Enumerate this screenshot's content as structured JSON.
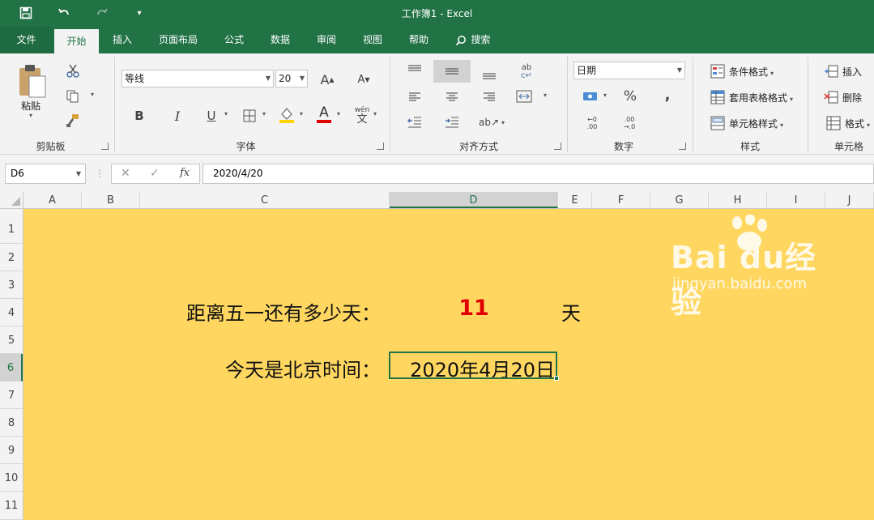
{
  "title": {
    "text": "工作簿1  -  Excel"
  },
  "tabs": [
    "文件",
    "开始",
    "插入",
    "页面布局",
    "公式",
    "数据",
    "审阅",
    "视图",
    "帮助",
    "搜索"
  ],
  "ribbon": {
    "clipboard": {
      "paste": "粘贴",
      "label": "剪贴板"
    },
    "font": {
      "name": "等线",
      "size": "20",
      "label": "字体",
      "bold": "B",
      "italic": "I",
      "underline": "U",
      "wen": "wén",
      "wen2": "文"
    },
    "align": {
      "label": "对齐方式"
    },
    "number": {
      "format": "日期",
      "percent": "%",
      "comma": ",",
      "label": "数字"
    },
    "styles": {
      "conditional": "条件格式",
      "table": "套用表格格式",
      "cell": "单元格样式",
      "label": "样式"
    },
    "cells": {
      "insert": "插入",
      "delete": "删除",
      "format": "格式",
      "label": "单元格"
    }
  },
  "formula_bar": {
    "namebox": "D6",
    "formula": "2020/4/20",
    "fx": "fx"
  },
  "columns": [
    "A",
    "B",
    "C",
    "D",
    "E",
    "F",
    "G",
    "H",
    "I",
    "J"
  ],
  "rows": [
    "1",
    "2",
    "3",
    "4",
    "5",
    "6",
    "7",
    "8",
    "9",
    "10",
    "11"
  ],
  "cells": {
    "c4": "距离五一还有多少天：",
    "d4": "11",
    "e4": "天",
    "c6": "今天是北京时间：",
    "d6": "2020年4月20日"
  },
  "watermark": {
    "brand": "Bai du经验",
    "url": "jingyan.baidu.com"
  },
  "colors": {
    "green": "#217346",
    "sheet": "#ffd760",
    "red": "#e00000"
  }
}
